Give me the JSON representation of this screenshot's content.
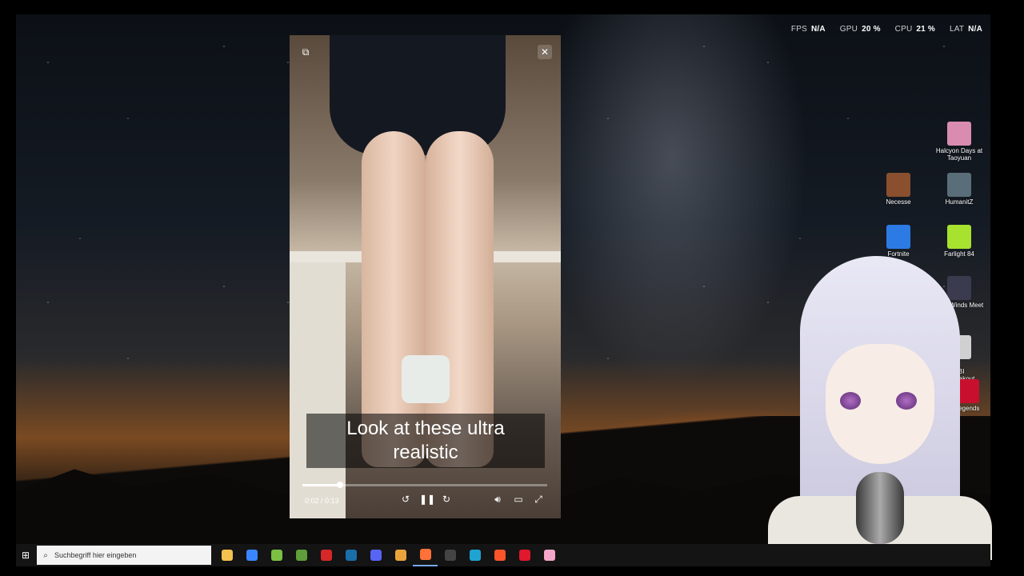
{
  "stats": [
    {
      "key": "FPS",
      "value": "N/A"
    },
    {
      "key": "GPU",
      "value": "20 %"
    },
    {
      "key": "CPU",
      "value": "21 %"
    },
    {
      "key": "LAT",
      "value": "N/A"
    }
  ],
  "desktop_icons": [
    {
      "label": "Halcyon Days at Taoyuan",
      "color": "#d98cb0"
    },
    {
      "label": "Necesse",
      "color": "#8a4f2e"
    },
    {
      "label": "HumanitZ",
      "color": "#5a6e7a"
    },
    {
      "label": "Fortnite",
      "color": "#2c7be5"
    },
    {
      "label": "Farlight 84",
      "color": "#a6e22e"
    },
    {
      "label": "here Winds Meet",
      "color": "#3b3b4f"
    },
    {
      "label": "ABI\na Breakout\nnfinite",
      "color": "#d0d0d0"
    },
    {
      "label": "Legends",
      "color": "#c8102e"
    }
  ],
  "player": {
    "caption": "Look at these ultra realistic",
    "current_time": "0:02",
    "total_time": "0:13",
    "progress": 0.154,
    "icons": [
      "picture-in-picture-icon",
      "close-icon",
      "rewind-icon",
      "pause-icon",
      "forward-icon",
      "volume-icon",
      "captions-icon",
      "fullscreen-icon"
    ]
  },
  "taskbar": {
    "search_placeholder": "Suchbegriff hier eingeben",
    "apps": [
      {
        "name": "file-explorer",
        "color": "#f2c14e"
      },
      {
        "name": "store",
        "color": "#3a86ff"
      },
      {
        "name": "xbox",
        "color": "#7bc043"
      },
      {
        "name": "minecraft",
        "color": "#5f9e3b"
      },
      {
        "name": "magix",
        "color": "#d62828"
      },
      {
        "name": "steam",
        "color": "#1b6fa8"
      },
      {
        "name": "discord",
        "color": "#5865f2"
      },
      {
        "name": "chrome",
        "color": "#e8a33d"
      },
      {
        "name": "firefox",
        "color": "#ff7139"
      },
      {
        "name": "obs",
        "color": "#444"
      },
      {
        "name": "vscode-insiders",
        "color": "#1fa3d1"
      },
      {
        "name": "brave",
        "color": "#fb542b"
      },
      {
        "name": "opera",
        "color": "#e0182d"
      },
      {
        "name": "vtube-studio",
        "color": "#f4a6c9"
      }
    ]
  }
}
